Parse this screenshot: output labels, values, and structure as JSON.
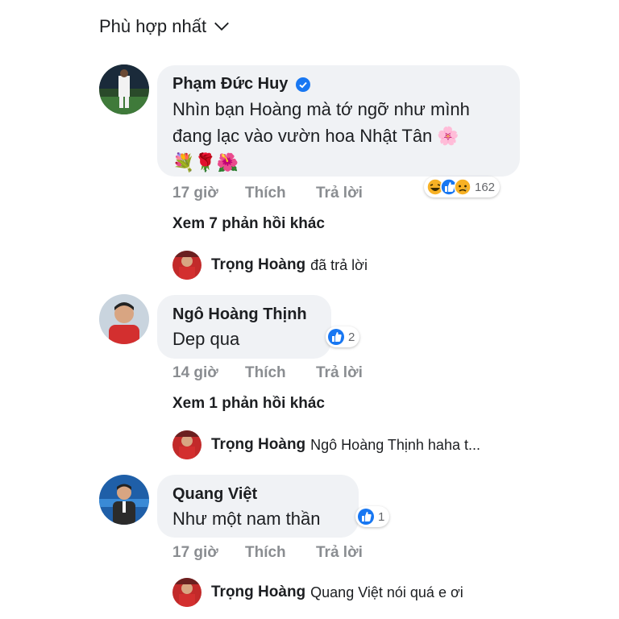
{
  "sort": {
    "label": "Phù hợp nhất"
  },
  "comments": [
    {
      "author": "Phạm Đức Huy",
      "verified": true,
      "text_line1": "Nhìn bạn Hoàng mà tớ ngỡ như mình",
      "text_line2": "đang lạc vào vườn hoa Nhật Tân 🌸",
      "text_line3": "💐🌹🌺",
      "time": "17 giờ",
      "like": "Thích",
      "reply": "Trả lời",
      "reaction_count": "162",
      "reaction_icons": [
        "haha-icon",
        "like-icon",
        "sad-icon"
      ],
      "more_replies": "Xem 7 phản hồi khác",
      "last_reply": {
        "name": "Trọng Hoàng",
        "text": "đã trả lời"
      }
    },
    {
      "author": "Ngô Hoàng Thịnh",
      "text_line1": "Dep qua",
      "time": "14 giờ",
      "like": "Thích",
      "reply": "Trả lời",
      "reaction_count": "2",
      "more_replies": "Xem 1 phản hồi khác",
      "last_reply": {
        "name": "Trọng Hoàng",
        "text": "Ngô Hoàng Thịnh  haha t..."
      }
    },
    {
      "author": "Quang Việt",
      "text_line1": "Như một nam thần",
      "time": "17 giờ",
      "like": "Thích",
      "reply": "Trả lời",
      "reaction_count": "1",
      "last_reply": {
        "name": "Trọng Hoàng",
        "text": "Quang Việt  nói quá e ơi"
      }
    }
  ],
  "colors": {
    "bubble": "#f0f2f5",
    "meta": "#8a8d91",
    "like_blue": "#1877f2",
    "verified": "#1877f2"
  }
}
